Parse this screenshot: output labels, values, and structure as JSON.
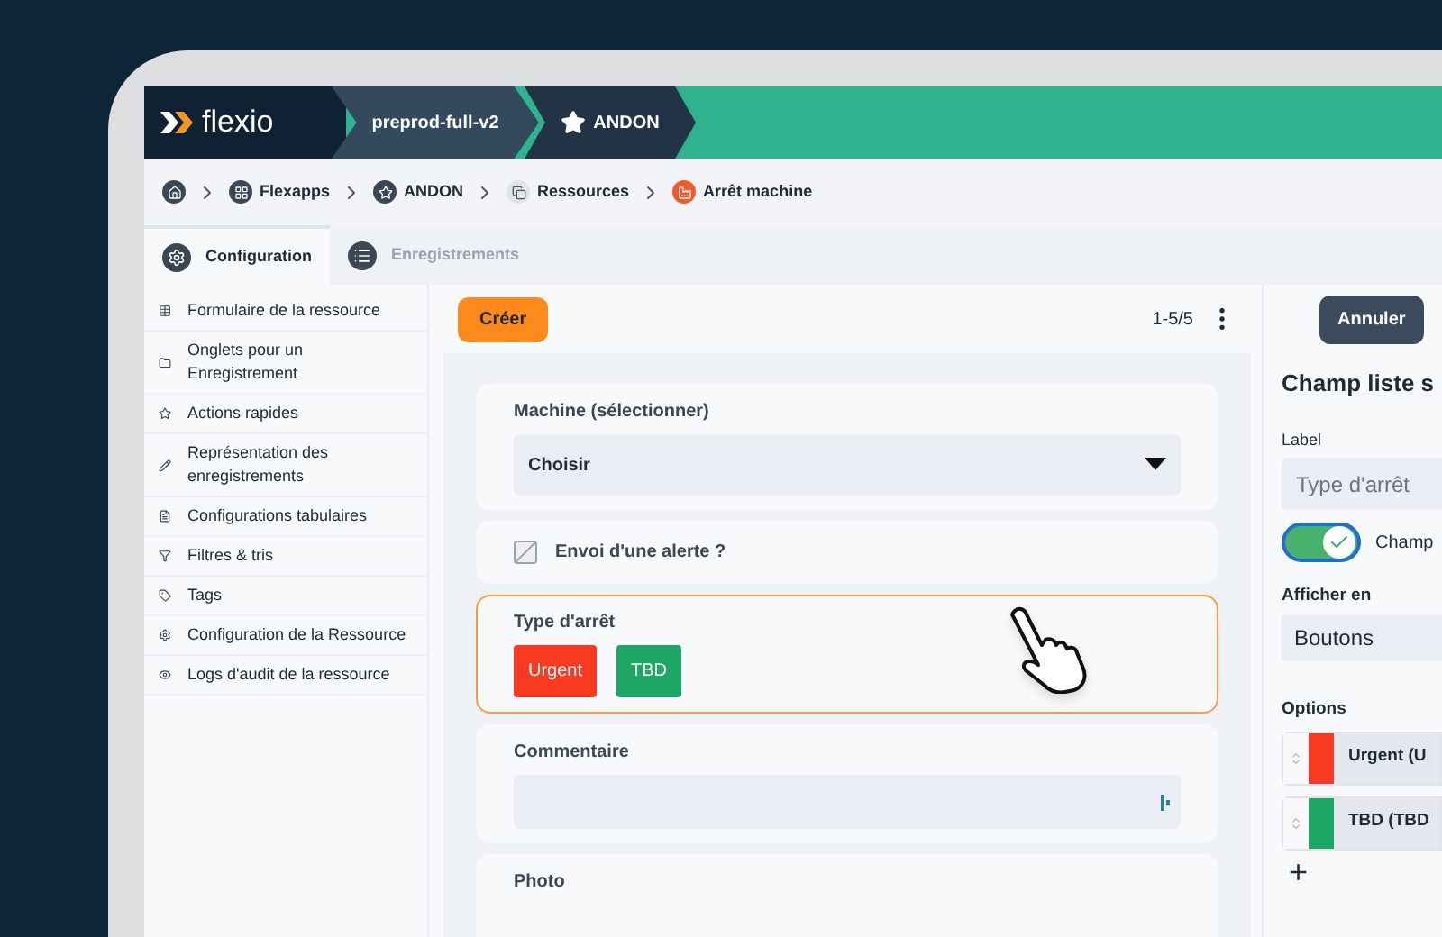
{
  "header": {
    "logo": "flexio",
    "segments": [
      {
        "label": "preprod-full-v2",
        "kind": "env"
      },
      {
        "label": "ANDON",
        "kind": "app"
      }
    ]
  },
  "breadcrumb": [
    {
      "label": "Flexapps"
    },
    {
      "label": "ANDON"
    },
    {
      "label": "Ressources"
    },
    {
      "label": "Arrêt machine"
    }
  ],
  "tabs": [
    {
      "label": "Configuration",
      "selected": true
    },
    {
      "label": "Enregistrements",
      "selected": false
    }
  ],
  "sidebar": {
    "items": [
      {
        "label": "Formulaire de la ressource"
      },
      {
        "label": "Onglets pour un Enregistrement"
      },
      {
        "label": "Actions rapides"
      },
      {
        "label": "Représentation des enregistrements"
      },
      {
        "label": "Configurations tabulaires"
      },
      {
        "label": "Filtres & tris"
      },
      {
        "label": "Tags"
      },
      {
        "label": "Configuration de la Ressource"
      },
      {
        "label": "Logs d'audit de la ressource"
      }
    ]
  },
  "toolbar": {
    "create_button": "Créer",
    "pagination": "1-5/5"
  },
  "form": [
    {
      "kind": "select",
      "label": "Machine (sélectionner)",
      "value": "Choisir",
      "selected": false
    },
    {
      "kind": "checkbox",
      "label": "Envoi d'une alerte ?",
      "disabled": true,
      "selected": false
    },
    {
      "kind": "buttons",
      "label": "Type d'arrêt",
      "selected": true,
      "options": [
        {
          "label": "Urgent",
          "color": "#f93a22"
        },
        {
          "label": "TBD",
          "color": "#1ea764"
        }
      ]
    },
    {
      "kind": "text",
      "label": "Commentaire",
      "selected": false
    },
    {
      "kind": "photo",
      "label": "Photo",
      "selected": false
    }
  ],
  "editor": {
    "cancel_button": "Annuler",
    "title": "Champ liste s",
    "label_label": "Label",
    "label_value": "Type d'arrêt",
    "toggle": {
      "label": "Champ",
      "on": true
    },
    "display_label": "Afficher en",
    "display_value": "Boutons",
    "options_label": "Options",
    "options": [
      {
        "label": "Urgent (U",
        "color": "#f93a22"
      },
      {
        "label": "TBD (TBD",
        "color": "#1ea764"
      }
    ],
    "add_button": "+"
  }
}
